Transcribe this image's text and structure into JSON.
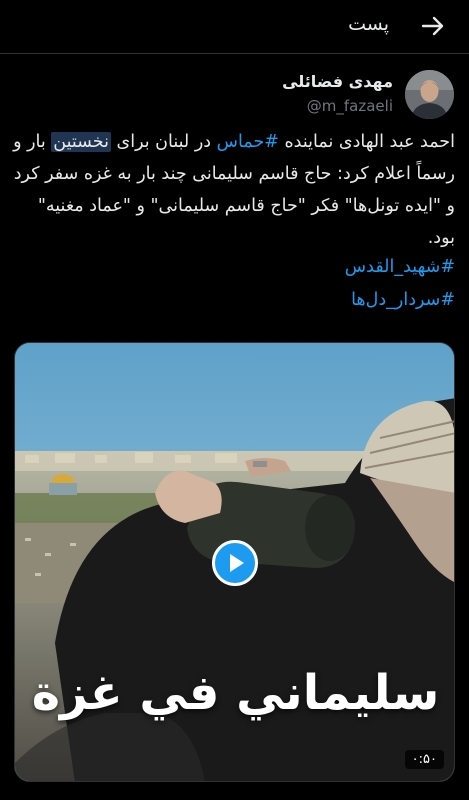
{
  "header": {
    "title": "پست",
    "back_icon": "arrow-right-icon"
  },
  "author": {
    "name": "مهدی فضائلی",
    "handle": "@m_fazaeli"
  },
  "tweet": {
    "line1_pre": "احمد عبد الهادی نماینده ",
    "hashtag1": "#حماس",
    "line1_mid": " در لبنان برای ",
    "highlight": "نخستین",
    "line_rest": " بار و رسماً اعلام کرد: حاج قاسم سلیمانی چند بار به غزه سفر کرد و \"ایده تونل‌ها\" فکر \"حاج قاسم سلیمانی\" و \"عماد مغنیه\" بود.",
    "hashtag2": "#شهید_القدس",
    "hashtag3": "#سردار_دل‌ها"
  },
  "media": {
    "overlay_text": "سليماني في غزة",
    "duration": "۰:۵۰",
    "play_icon": "play-icon"
  },
  "colors": {
    "accent": "#1d9bf0",
    "background": "#000000",
    "text": "#e7e9ea",
    "muted": "#71767b"
  }
}
